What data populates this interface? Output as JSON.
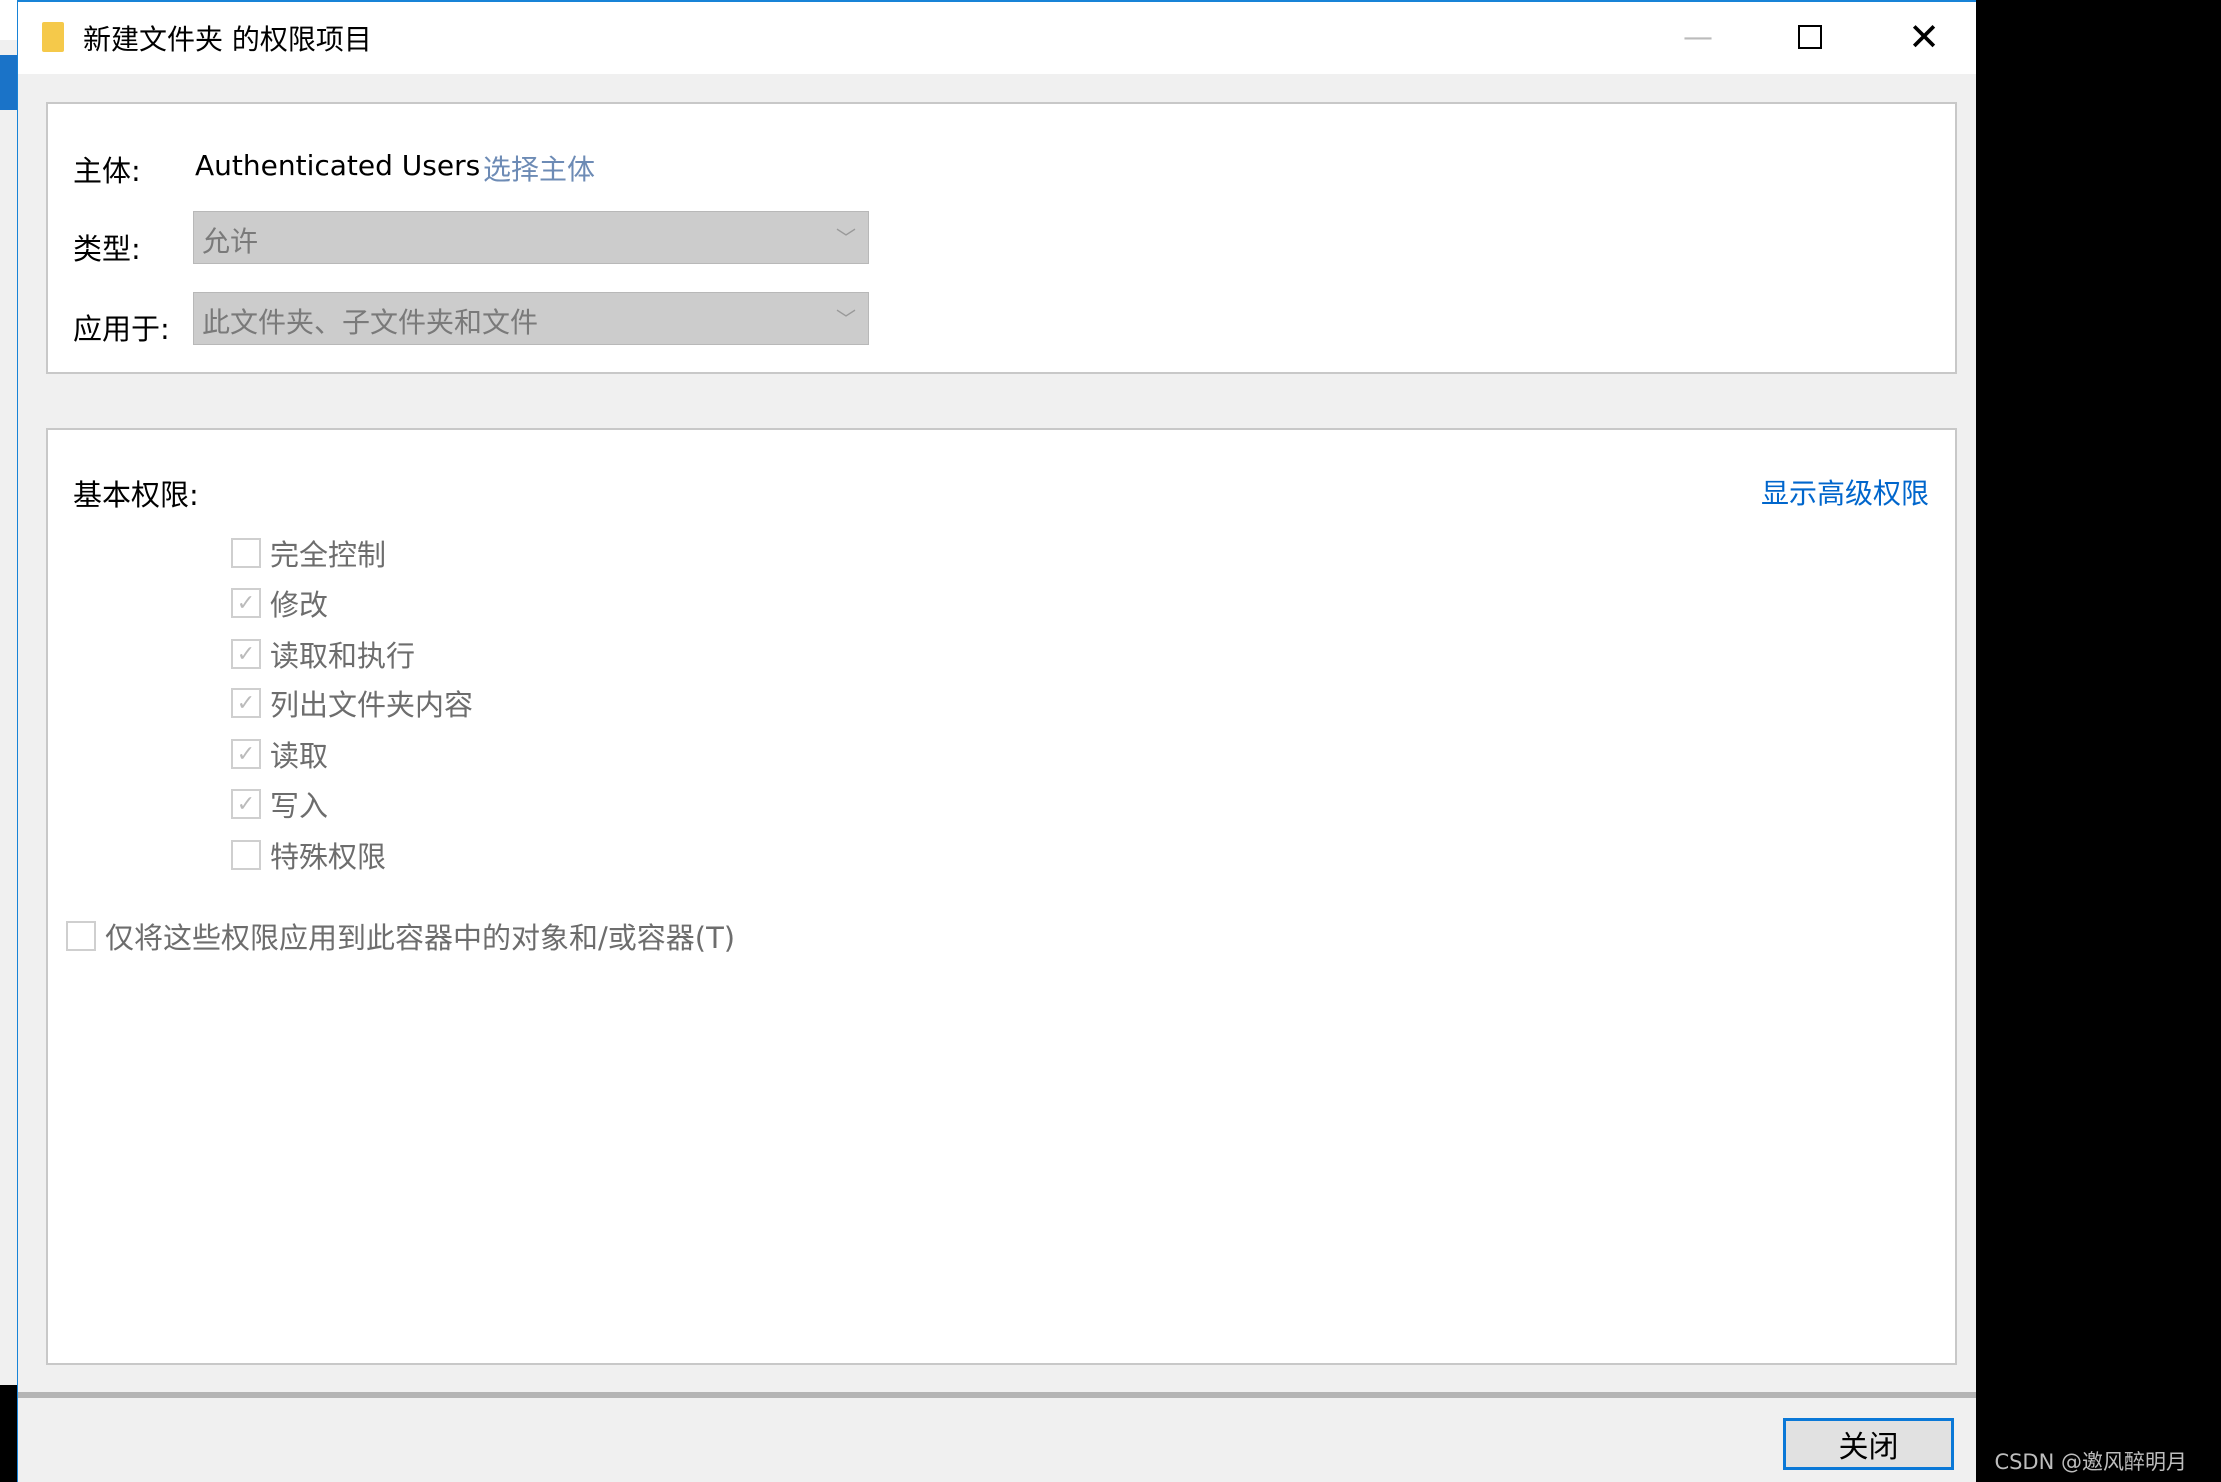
{
  "window": {
    "title": "新建文件夹 的权限项目"
  },
  "principal": {
    "label": "主体:",
    "value": "Authenticated Users",
    "select_link": "选择主体"
  },
  "type": {
    "label": "类型:",
    "value": "允许"
  },
  "applies_to": {
    "label": "应用于:",
    "value": "此文件夹、子文件夹和文件"
  },
  "permissions": {
    "heading": "基本权限:",
    "advanced_link": "显示高级权限",
    "items": [
      {
        "label": "完全控制",
        "checked": false
      },
      {
        "label": "修改",
        "checked": true
      },
      {
        "label": "读取和执行",
        "checked": true
      },
      {
        "label": "列出文件夹内容",
        "checked": true
      },
      {
        "label": "读取",
        "checked": true
      },
      {
        "label": "写入",
        "checked": true
      },
      {
        "label": "特殊权限",
        "checked": false
      }
    ],
    "apply_only": {
      "label": "仅将这些权限应用到此容器中的对象和/或容器(T)",
      "checked": false
    }
  },
  "footer": {
    "close_label": "关闭"
  },
  "watermark": "CSDN @邀风醉明月"
}
